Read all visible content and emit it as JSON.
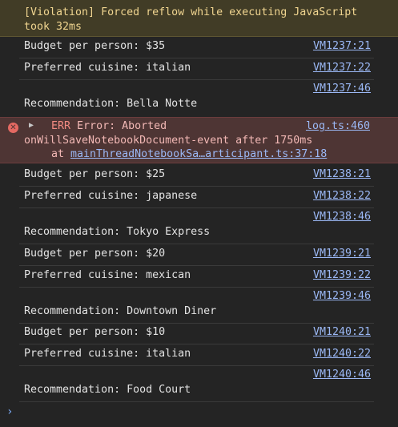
{
  "violation": {
    "message": "[Violation] Forced reflow while executing JavaScript took 32ms"
  },
  "group1": [
    {
      "text": "Budget per person: $35",
      "source": "VM1237:21"
    },
    {
      "text": "Preferred cuisine: italian",
      "source": "VM1237:22"
    },
    {
      "text": "Recommendation: Bella Notte",
      "source": "VM1237:46"
    }
  ],
  "error": {
    "label": "ERR",
    "line1": "Error: Aborted",
    "line2": "onWillSaveNotebookDocument-event after 1750ms",
    "line3_prefix": "at ",
    "line3_link": "mainThreadNotebookSa…articipant.ts:37:18",
    "source": "log.ts:460"
  },
  "group2": [
    {
      "text": "Budget per person: $25",
      "source": "VM1238:21"
    },
    {
      "text": "Preferred cuisine: japanese",
      "source": "VM1238:22"
    },
    {
      "text": "Recommendation: Tokyo Express",
      "source": "VM1238:46"
    }
  ],
  "group3": [
    {
      "text": "Budget per person: $20",
      "source": "VM1239:21"
    },
    {
      "text": "Preferred cuisine: mexican",
      "source": "VM1239:22"
    },
    {
      "text": "Recommendation: Downtown Diner",
      "source": "VM1239:46"
    }
  ],
  "group4": [
    {
      "text": "Budget per person: $10",
      "source": "VM1240:21"
    },
    {
      "text": "Preferred cuisine: italian",
      "source": "VM1240:22"
    },
    {
      "text": "Recommendation: Food Court",
      "source": "VM1240:46"
    }
  ],
  "icons": {
    "error": "error-circle-icon",
    "expand": "expand-triangle-icon",
    "prompt": "console-prompt-chevron-icon"
  },
  "colors": {
    "background": "#242424",
    "violation_bg": "#413c26",
    "violation_text": "#f0d590",
    "error_bg": "#4e3534",
    "error_text": "#f2b8b5",
    "link": "#9bb8f5"
  }
}
